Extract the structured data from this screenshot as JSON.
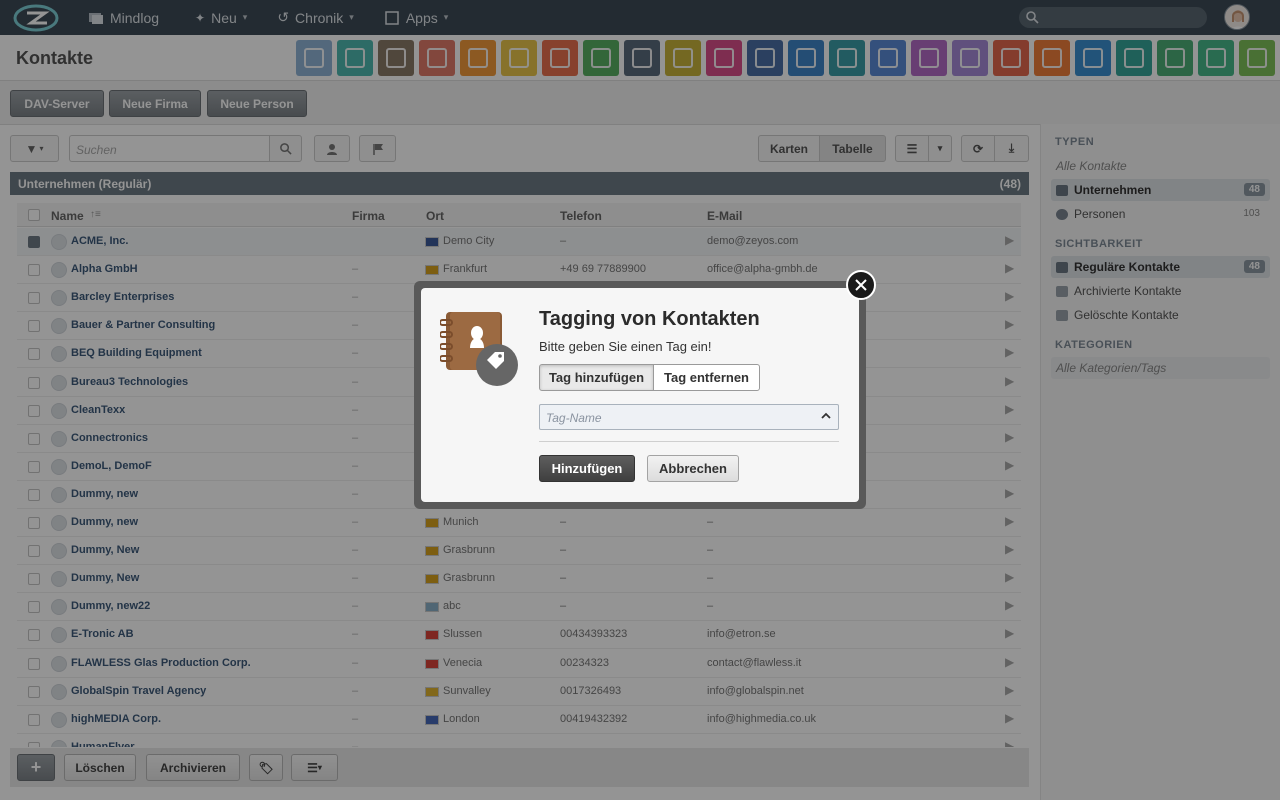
{
  "topbar": {
    "nav": [
      {
        "label": "Mindlog",
        "icon": "mindlog-icon"
      },
      {
        "label": "Neu",
        "icon": "sparkle-icon"
      },
      {
        "label": "Chronik",
        "icon": "history-icon"
      },
      {
        "label": "Apps",
        "icon": "apps-grid-icon"
      }
    ]
  },
  "page": {
    "title": "Kontakte"
  },
  "app_colors": [
    "#8fb3d6",
    "#4fb8b0",
    "#8a7a68",
    "#e07b6a",
    "#f29a3c",
    "#e9c54a",
    "#e8704f",
    "#58b062",
    "#5a6b7c",
    "#c9b43c",
    "#d94f8a",
    "#4a6fa5",
    "#3f86c8",
    "#3c9ea8",
    "#5b8bd6",
    "#b36bc7",
    "#a58ad8",
    "#e4684f",
    "#ef7f3c",
    "#3b8fd0",
    "#36a59a",
    "#4cae78",
    "#48b88a",
    "#7fc25a"
  ],
  "toolbar": {
    "dav": "DAV-Server",
    "firma": "Neue Firma",
    "person": "Neue Person"
  },
  "search": {
    "placeholder": "Suchen"
  },
  "view": {
    "karten": "Karten",
    "tabelle": "Tabelle"
  },
  "section": {
    "title": "Unternehmen (Regulär)",
    "count": "(48)"
  },
  "table": {
    "columns": {
      "name": "Name",
      "firma": "Firma",
      "ort": "Ort",
      "telefon": "Telefon",
      "email": "E-Mail"
    },
    "rows": [
      {
        "name": "ACME, Inc.",
        "firma": "",
        "ort": "Demo City",
        "telefon": "–",
        "email": "demo@zeyos.com",
        "flag": "us",
        "selected": true
      },
      {
        "name": "Alpha GmbH",
        "firma": "–",
        "ort": "Frankfurt",
        "telefon": "+49 69 77889900",
        "email": "office@alpha-gmbh.de",
        "flag": "de"
      },
      {
        "name": "Barcley Enterprises",
        "firma": "–",
        "ort": "",
        "telefon": "",
        "email": "",
        "flag": ""
      },
      {
        "name": "Bauer & Partner Consulting",
        "firma": "–",
        "ort": "",
        "telefon": "",
        "email": "",
        "flag": ""
      },
      {
        "name": "BEQ Building Equipment",
        "firma": "–",
        "ort": "",
        "telefon": "",
        "email": "",
        "flag": ""
      },
      {
        "name": "Bureau3 Technologies",
        "firma": "–",
        "ort": "",
        "telefon": "",
        "email": "",
        "flag": ""
      },
      {
        "name": "CleanTexx",
        "firma": "–",
        "ort": "",
        "telefon": "",
        "email": "",
        "flag": ""
      },
      {
        "name": "Connectronics",
        "firma": "–",
        "ort": "",
        "telefon": "",
        "email": "",
        "flag": ""
      },
      {
        "name": "DemoL, DemoF",
        "firma": "–",
        "ort": "",
        "telefon": "",
        "email": "",
        "flag": ""
      },
      {
        "name": "Dummy, new",
        "firma": "–",
        "ort": "",
        "telefon": "",
        "email": "",
        "flag": ""
      },
      {
        "name": "Dummy, new",
        "firma": "–",
        "ort": "Munich",
        "telefon": "–",
        "email": "–",
        "flag": "de"
      },
      {
        "name": "Dummy, New",
        "firma": "–",
        "ort": "Grasbrunn",
        "telefon": "–",
        "email": "–",
        "flag": "de"
      },
      {
        "name": "Dummy, New",
        "firma": "–",
        "ort": "Grasbrunn",
        "telefon": "–",
        "email": "–",
        "flag": "de"
      },
      {
        "name": "Dummy, new22",
        "firma": "–",
        "ort": "abc",
        "telefon": "–",
        "email": "–",
        "flag": "other"
      },
      {
        "name": "E-Tronic AB",
        "firma": "–",
        "ort": "Slussen",
        "telefon": "00434393323",
        "email": "info@etron.se",
        "flag": "ca"
      },
      {
        "name": "FLAWLESS Glas Production Corp.",
        "firma": "–",
        "ort": "Venecia",
        "telefon": "00234323",
        "email": "contact@flawless.it",
        "flag": "ca"
      },
      {
        "name": "GlobalSpin Travel Agency",
        "firma": "–",
        "ort": "Sunvalley",
        "telefon": "0017326493",
        "email": "info@globalspin.net",
        "flag": "es"
      },
      {
        "name": "highMEDIA Corp.",
        "firma": "–",
        "ort": "London",
        "telefon": "00419432392",
        "email": "info@highmedia.co.uk",
        "flag": "fr"
      },
      {
        "name": "HumanFlyer",
        "firma": "–",
        "ort": "",
        "telefon": "",
        "email": "",
        "flag": ""
      }
    ]
  },
  "bottom": {
    "add": "+",
    "delete": "Löschen",
    "archive": "Archivieren"
  },
  "sidebar": {
    "typen_head": "TYPEN",
    "alle": "Alle Kontakte",
    "unternehmen": "Unternehmen",
    "unternehmen_count": "48",
    "personen": "Personen",
    "personen_count": "103",
    "sicht_head": "SICHTBARKEIT",
    "regulaer": "Reguläre Kontakte",
    "regulaer_count": "48",
    "archiviert": "Archivierte Kontakte",
    "geloescht": "Gelöschte Kontakte",
    "kat_head": "KATEGORIEN",
    "alle_kat": "Alle Kategorien/Tags"
  },
  "dialog": {
    "title": "Tagging von Kontakten",
    "subtitle": "Bitte geben Sie einen Tag ein!",
    "tab_add": "Tag hinzufügen",
    "tab_remove": "Tag entfernen",
    "tag_placeholder": "Tag-Name",
    "confirm": "Hinzufügen",
    "cancel": "Abbrechen"
  }
}
